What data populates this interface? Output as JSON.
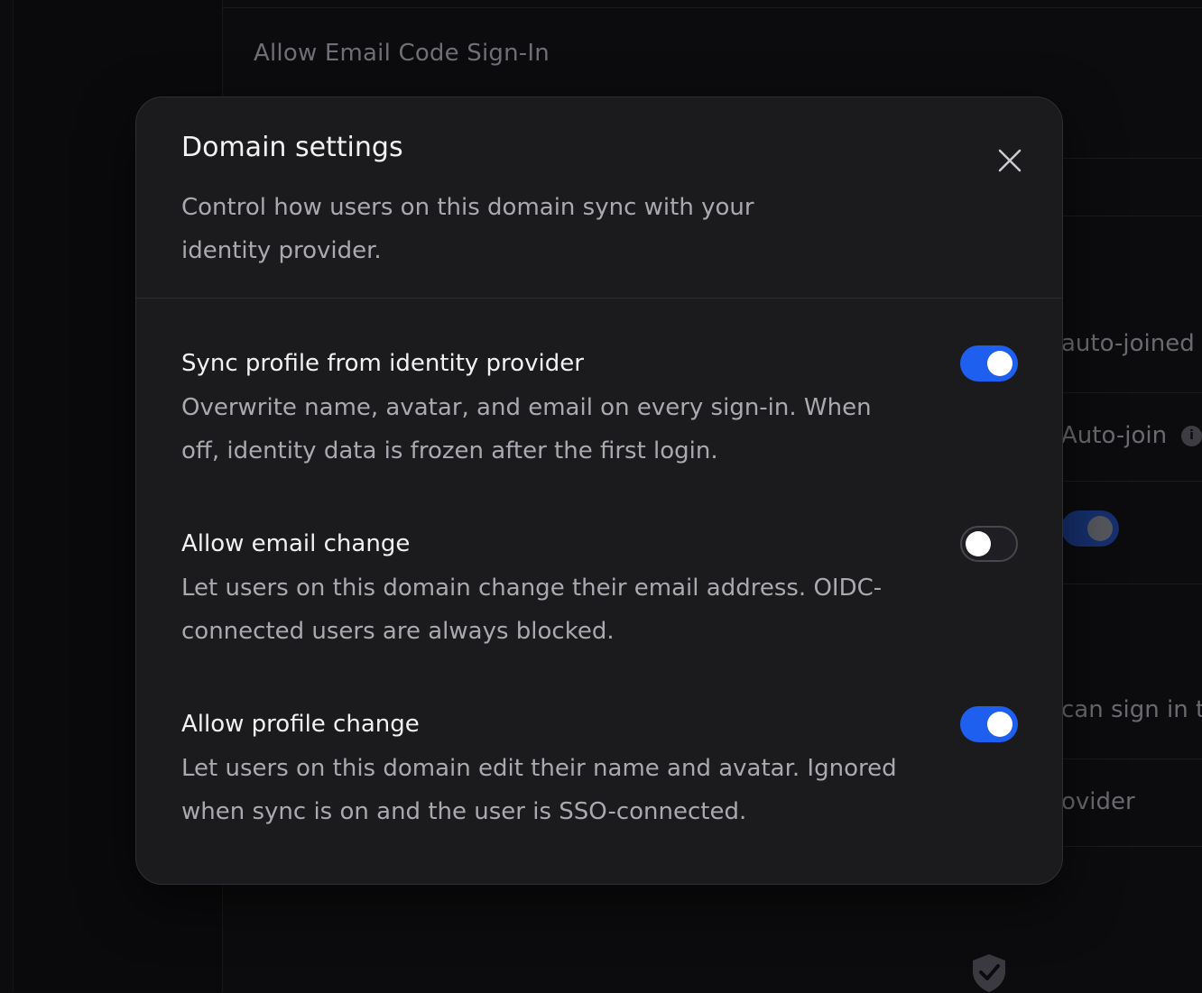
{
  "background": {
    "section_title": "Allow Email Code Sign-In",
    "right_texts": {
      "auto_joined": "auto-joined a",
      "auto_join": "Auto-join",
      "can_sign_in": "can sign in th",
      "provider": "ovider"
    },
    "info_icon": "info-icon",
    "shield_icon": "shield-check-icon"
  },
  "modal": {
    "title": "Domain settings",
    "description": "Control how users on this domain sync with your identity provider.",
    "close_icon": "close-icon",
    "settings": [
      {
        "title": "Sync profile from identity provider",
        "description": "Overwrite name, avatar, and email on every sign-in. When off, identity data is frozen after the first login.",
        "enabled": true
      },
      {
        "title": "Allow email change",
        "description": "Let users on this domain change their email address. OIDC-connected users are always blocked.",
        "enabled": false
      },
      {
        "title": "Allow profile change",
        "description": "Let users on this domain edit their name and avatar. Ignored when sync is on and the user is SSO-connected.",
        "enabled": true
      }
    ]
  },
  "colors": {
    "accent": "#1f5ff0",
    "modal_bg": "#1b1b1e",
    "page_bg": "#0c0c0e"
  }
}
